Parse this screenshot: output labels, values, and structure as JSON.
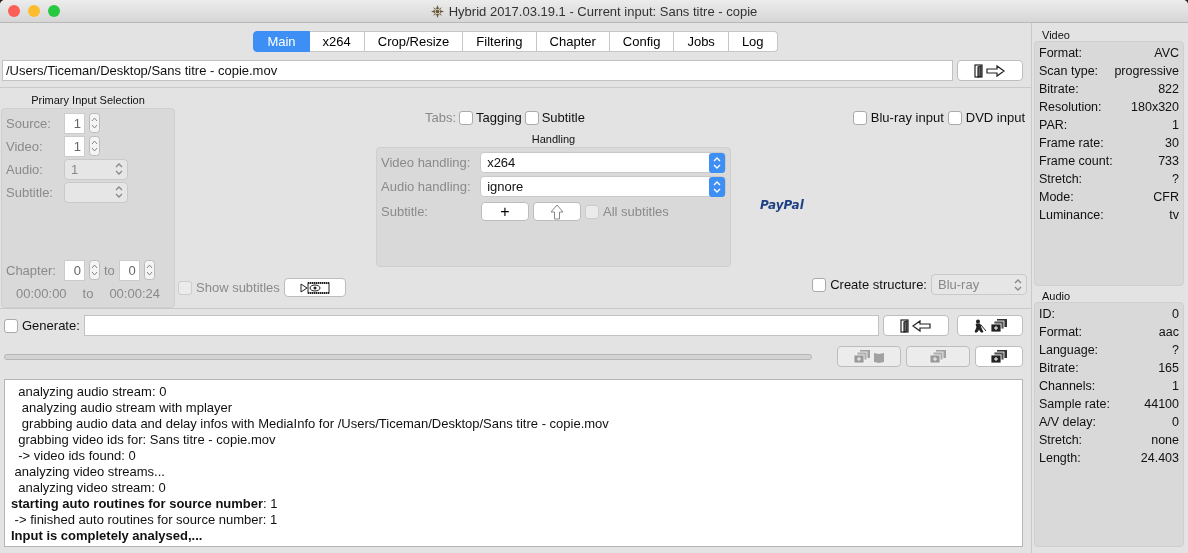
{
  "window": {
    "title": "Hybrid 2017.03.19.1 - Current input: Sans titre - copie"
  },
  "tabs": [
    {
      "label": "Main",
      "selected": true
    },
    {
      "label": "x264",
      "selected": false
    },
    {
      "label": "Crop/Resize",
      "selected": false
    },
    {
      "label": "Filtering",
      "selected": false
    },
    {
      "label": "Chapter",
      "selected": false
    },
    {
      "label": "Config",
      "selected": false
    },
    {
      "label": "Jobs",
      "selected": false
    },
    {
      "label": "Log",
      "selected": false
    }
  ],
  "source_path": {
    "value": "/Users/Ticeman/Desktop/Sans titre - copie.mov"
  },
  "primary_input": {
    "title": "Primary Input Selection",
    "disabled": true,
    "source": {
      "label": "Source:",
      "value": "1"
    },
    "video": {
      "label": "Video:",
      "value": "1"
    },
    "audio": {
      "label": "Audio:",
      "value": "1"
    },
    "subtitle": {
      "label": "Subtitle:"
    },
    "chapter": {
      "label": "Chapter:",
      "from": "0",
      "to_label": "to",
      "to": "0"
    },
    "times": {
      "start": "00:00:00",
      "to_label": "to",
      "end": "00:00:24"
    }
  },
  "show_subtitles": {
    "label": "Show subtitles",
    "checked": false,
    "disabled": true
  },
  "tab_options": {
    "label": "Tabs:",
    "items": [
      {
        "label": "Tagging",
        "checked": false
      },
      {
        "label": "Subtitle",
        "checked": false
      }
    ]
  },
  "input_types": [
    {
      "label": "Blu-ray input",
      "checked": false
    },
    {
      "label": "DVD input",
      "checked": false
    }
  ],
  "handling": {
    "title": "Handling",
    "video": {
      "label": "Video handling:",
      "value": "x264"
    },
    "audio": {
      "label": "Audio handling:",
      "value": "ignore"
    },
    "subtitle": {
      "label": "Subtitle:",
      "add": "+"
    },
    "all_subtitles": {
      "label": "All subtitles",
      "checked": false,
      "disabled": true
    }
  },
  "paypal": {
    "label": "PayPal"
  },
  "create_structure": {
    "label": "Create structure:",
    "checked": false,
    "value": "Blu-ray",
    "disabled": true
  },
  "generate": {
    "label": "Generate:",
    "checked": false
  },
  "progress": {
    "level": 0
  },
  "log": [
    {
      "text": "  analyzing audio stream: 0",
      "bold": false
    },
    {
      "text": "   analyzing audio stream with mplayer",
      "bold": false
    },
    {
      "text": "   grabbing audio data and delay infos with MediaInfo for /Users/Ticeman/Desktop/Sans titre - copie.mov",
      "bold": false
    },
    {
      "text": "  grabbing video ids for: Sans titre - copie.mov",
      "bold": false
    },
    {
      "text": "  -> video ids found: 0",
      "bold": false
    },
    {
      "text": " analyzing video streams...",
      "bold": false
    },
    {
      "text": "  analyzing video stream: 0",
      "bold": false
    },
    {
      "text": "**starting auto routines for source number**: 1",
      "bold": false
    },
    {
      "text": " -> finished auto routines for source number: 1",
      "bold": false
    },
    {
      "text": "Input is completely analysed,...",
      "bold": true
    }
  ],
  "video_info": {
    "title": "Video",
    "rows": [
      {
        "label": "Format:",
        "value": "AVC"
      },
      {
        "label": "Scan type:",
        "value": "progressive"
      },
      {
        "label": "Bitrate:",
        "value": "822"
      },
      {
        "label": "Resolution:",
        "value": "180x320"
      },
      {
        "label": "PAR:",
        "value": "1"
      },
      {
        "label": "Frame rate:",
        "value": "30"
      },
      {
        "label": "Frame count:",
        "value": "733"
      },
      {
        "label": "Stretch:",
        "value": "?"
      },
      {
        "label": "Mode:",
        "value": "CFR"
      },
      {
        "label": "Luminance:",
        "value": "tv"
      }
    ]
  },
  "audio_info": {
    "title": "Audio",
    "rows": [
      {
        "label": "ID:",
        "value": "0"
      },
      {
        "label": "Format:",
        "value": "aac"
      },
      {
        "label": "Language:",
        "value": "?"
      },
      {
        "label": "Bitrate:",
        "value": "165"
      },
      {
        "label": "Channels:",
        "value": "1"
      },
      {
        "label": "Sample rate:",
        "value": "44100"
      },
      {
        "label": "A/V delay:",
        "value": "0"
      },
      {
        "label": "Stretch:",
        "value": "none"
      },
      {
        "label": "Length:",
        "value": "24.403"
      }
    ]
  }
}
